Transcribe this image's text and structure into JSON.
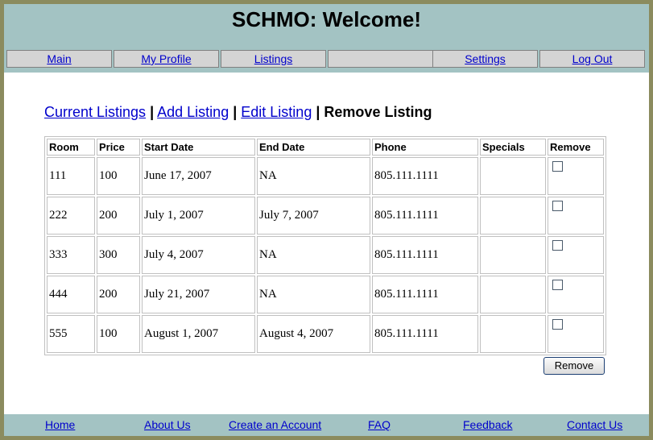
{
  "header": {
    "title": "SCHMO: Welcome!"
  },
  "nav": {
    "main": "Main",
    "profile": "My Profile",
    "listings": "Listings",
    "blank": "",
    "settings": "Settings",
    "logout": "Log Out"
  },
  "subnav": {
    "current_listings": "Current Listings",
    "add_listing": "Add Listing",
    "edit_listing": "Edit Listing",
    "remove_listing": "Remove Listing",
    "sep": "|"
  },
  "table": {
    "headers": [
      "Room",
      "Price",
      "Start Date",
      "End Date",
      "Phone",
      "Specials",
      "Remove"
    ],
    "rows": [
      {
        "room": "111",
        "price": "100",
        "start": "June 17, 2007",
        "end": "NA",
        "phone": "805.111.1111",
        "specials": ""
      },
      {
        "room": "222",
        "price": "200",
        "start": "July 1, 2007",
        "end": "July 7, 2007",
        "phone": "805.111.1111",
        "specials": ""
      },
      {
        "room": "333",
        "price": "300",
        "start": "July 4, 2007",
        "end": "NA",
        "phone": "805.111.1111",
        "specials": ""
      },
      {
        "room": "444",
        "price": "200",
        "start": "July 21, 2007",
        "end": "NA",
        "phone": "805.111.1111",
        "specials": ""
      },
      {
        "room": "555",
        "price": "100",
        "start": "August 1, 2007",
        "end": "August 4, 2007",
        "phone": "805.111.1111",
        "specials": ""
      }
    ]
  },
  "remove_button": "Remove",
  "footer": {
    "home": "Home",
    "about": "About Us",
    "create": "Create an Account",
    "faq": "FAQ",
    "feedback": "Feedback",
    "contact": "Contact Us"
  }
}
